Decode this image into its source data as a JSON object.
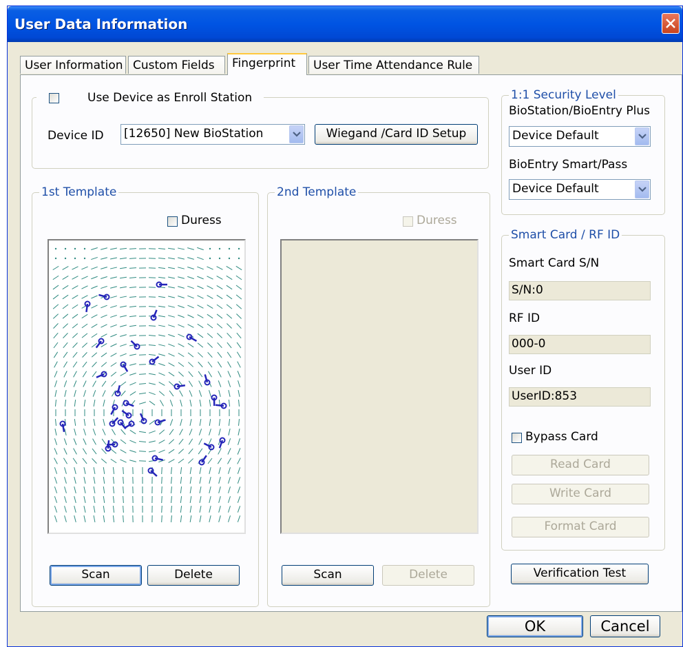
{
  "window": {
    "title": "User Data Information"
  },
  "tabs": [
    {
      "label": "User Information",
      "active": false
    },
    {
      "label": "Custom Fields",
      "active": false
    },
    {
      "label": "Fingerprint",
      "active": true
    },
    {
      "label": "User Time Attendance Rule",
      "active": false
    }
  ],
  "enroll": {
    "checkbox_label": "Use Device as Enroll Station",
    "checked": false,
    "device_id_label": "Device ID",
    "device_selected": "[12650] New BioStation",
    "wiegand_button": "Wiegand /Card ID Setup"
  },
  "template1": {
    "title": "1st Template",
    "duress_label": "Duress",
    "duress_checked": false,
    "scan_button": "Scan",
    "delete_button": "Delete"
  },
  "template2": {
    "title": "2nd Template",
    "duress_label": "Duress",
    "duress_checked": false,
    "scan_button": "Scan",
    "delete_button": "Delete"
  },
  "security": {
    "title": "1:1 Security Level",
    "biostation_label": "BioStation/BioEntry Plus",
    "biostation_value": "Device Default",
    "bioentry_label": "BioEntry Smart/Pass",
    "bioentry_value": "Device Default"
  },
  "smartcard": {
    "title": "Smart Card / RF ID",
    "sn_label": "Smart Card S/N",
    "sn_value": "S/N:0",
    "rfid_label": "RF ID",
    "rfid_value": "000-0",
    "userid_label": "User ID",
    "userid_value": "UserID:853",
    "bypass_label": "Bypass Card",
    "bypass_checked": false,
    "read_button": "Read Card",
    "write_button": "Write Card",
    "format_button": "Format Card"
  },
  "verification_button": "Verification Test",
  "footer": {
    "ok_button": "OK",
    "cancel_button": "Cancel"
  },
  "colors": {
    "titlebar": "#0054e3",
    "group_title": "#1f4fa8",
    "ridge": "#2e8a80",
    "minutiae": "#2424b8"
  }
}
